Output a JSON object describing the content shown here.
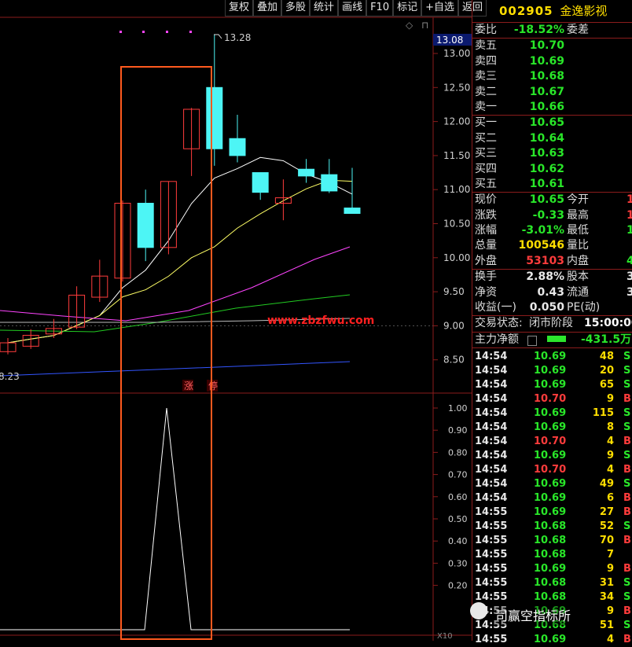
{
  "toolbar": [
    "复权",
    "叠加",
    "多股",
    "统计",
    "画线",
    "F10",
    "标记",
    "+自选",
    "返回"
  ],
  "colors": {
    "up": "#ff3c3c",
    "down": "#29e629",
    "flat": "#e8e8e8",
    "cyan_candle": "#4df5f5",
    "highlight_box": "#ff5a1e",
    "ma5": "#ffffff",
    "ma10": "#ffff66",
    "ma20": "#ff44ff",
    "ma60": "#22cc22",
    "ma_long": "#3355ff"
  },
  "chart": {
    "price_axis": [
      "13.00",
      "12.50",
      "12.00",
      "11.50",
      "11.00",
      "10.50",
      "10.00",
      "9.50",
      "9.00",
      "8.50"
    ],
    "current_price_tag": "13.08",
    "high_label": "13.28",
    "low_label": "8.23",
    "url_text": "www.zbzfwu.com",
    "signal_labels": [
      "涨",
      "停"
    ],
    "indicator_axis": [
      "1.00",
      "0.90",
      "0.80",
      "0.70",
      "0.60",
      "0.50",
      "0.40",
      "0.30",
      "0.20"
    ],
    "indicator_note": "X10",
    "candles": [
      {
        "o": 8.62,
        "c": 8.75,
        "h": 8.82,
        "l": 8.58
      },
      {
        "o": 8.7,
        "c": 8.86,
        "h": 8.95,
        "l": 8.66
      },
      {
        "o": 8.88,
        "c": 8.96,
        "h": 9.1,
        "l": 8.82
      },
      {
        "o": 8.98,
        "c": 9.45,
        "h": 9.58,
        "l": 8.95
      },
      {
        "o": 9.42,
        "c": 9.73,
        "h": 9.97,
        "l": 9.35
      },
      {
        "o": 9.7,
        "c": 10.8,
        "h": 10.84,
        "l": 9.65
      },
      {
        "o": 10.8,
        "c": 10.15,
        "h": 11.0,
        "l": 9.95
      },
      {
        "o": 10.15,
        "c": 11.12,
        "h": 11.12,
        "l": 10.05
      },
      {
        "o": 11.6,
        "c": 12.18,
        "h": 12.2,
        "l": 11.2
      },
      {
        "o": 12.5,
        "c": 11.6,
        "h": 13.28,
        "l": 11.35
      },
      {
        "o": 11.75,
        "c": 11.5,
        "h": 12.1,
        "l": 11.4
      },
      {
        "o": 11.25,
        "c": 10.96,
        "h": 11.25,
        "l": 10.85
      },
      {
        "o": 10.8,
        "c": 10.88,
        "h": 11.15,
        "l": 10.55
      },
      {
        "o": 11.3,
        "c": 11.2,
        "h": 11.45,
        "l": 11.1
      },
      {
        "o": 11.22,
        "c": 10.98,
        "h": 11.45,
        "l": 10.95
      },
      {
        "o": 10.73,
        "c": 10.65,
        "h": 11.32,
        "l": 10.65
      }
    ],
    "indicator_values": [
      0,
      0,
      0,
      0,
      0,
      0,
      0,
      1,
      0,
      0,
      0,
      0,
      0,
      0,
      0
    ]
  },
  "quote": {
    "code": "002905",
    "name": "金逸影视",
    "weibi_label": "委比",
    "weibi": "-18.52%",
    "weicha_label": "委差",
    "asks": [
      {
        "label": "卖五",
        "price": "10.70"
      },
      {
        "label": "卖四",
        "price": "10.69"
      },
      {
        "label": "卖三",
        "price": "10.68"
      },
      {
        "label": "卖二",
        "price": "10.67"
      },
      {
        "label": "卖一",
        "price": "10.66"
      }
    ],
    "bids": [
      {
        "label": "买一",
        "price": "10.65"
      },
      {
        "label": "买二",
        "price": "10.64"
      },
      {
        "label": "买三",
        "price": "10.63"
      },
      {
        "label": "买四",
        "price": "10.62"
      },
      {
        "label": "买五",
        "price": "10.61"
      }
    ],
    "stats1": [
      {
        "l1": "现价",
        "v1": "10.65",
        "c1": "green",
        "l2": "今开",
        "v2": "1",
        "c2": "red"
      },
      {
        "l1": "涨跌",
        "v1": "-0.33",
        "c1": "green",
        "l2": "最高",
        "v2": "1",
        "c2": "red"
      },
      {
        "l1": "涨幅",
        "v1": "-3.01%",
        "c1": "green",
        "l2": "最低",
        "v2": "1",
        "c2": "green"
      },
      {
        "l1": "总量",
        "v1": "100546",
        "c1": "yellow",
        "l2": "量比",
        "v2": "",
        "c2": "white"
      },
      {
        "l1": "外盘",
        "v1": "53103",
        "c1": "red",
        "l2": "内盘",
        "v2": "4",
        "c2": "green"
      }
    ],
    "stats2": [
      {
        "l1": "换手",
        "v1": "2.88%",
        "c1": "white",
        "l2": "股本",
        "v2": "3.",
        "c2": "white"
      },
      {
        "l1": "净资",
        "v1": "0.43",
        "c1": "white",
        "l2": "流通",
        "v2": "3.",
        "c2": "white"
      },
      {
        "l1": "收益(一)",
        "v1": "0.050",
        "c1": "white",
        "l2": "PE(动)",
        "v2": "",
        "c2": "white"
      }
    ],
    "trade_status_label": "交易状态:",
    "trade_status": "闭市阶段",
    "trade_time": "15:00:00",
    "main_flow_label": "主力净额",
    "main_flow_value": "-431.5万"
  },
  "ticks": [
    {
      "t": "14:54",
      "p": "10.69",
      "q": "48",
      "d": "S"
    },
    {
      "t": "14:54",
      "p": "10.69",
      "q": "20",
      "d": "S"
    },
    {
      "t": "14:54",
      "p": "10.69",
      "q": "65",
      "d": "S"
    },
    {
      "t": "14:54",
      "p": "10.70",
      "q": "9",
      "d": "B"
    },
    {
      "t": "14:54",
      "p": "10.69",
      "q": "115",
      "d": "S"
    },
    {
      "t": "14:54",
      "p": "10.69",
      "q": "8",
      "d": "S"
    },
    {
      "t": "14:54",
      "p": "10.70",
      "q": "4",
      "d": "B"
    },
    {
      "t": "14:54",
      "p": "10.69",
      "q": "9",
      "d": "S"
    },
    {
      "t": "14:54",
      "p": "10.70",
      "q": "4",
      "d": "B"
    },
    {
      "t": "14:54",
      "p": "10.69",
      "q": "49",
      "d": "S"
    },
    {
      "t": "14:54",
      "p": "10.69",
      "q": "6",
      "d": "B"
    },
    {
      "t": "14:55",
      "p": "10.69",
      "q": "27",
      "d": "B"
    },
    {
      "t": "14:55",
      "p": "10.68",
      "q": "52",
      "d": "S"
    },
    {
      "t": "14:55",
      "p": "10.68",
      "q": "70",
      "d": "B"
    },
    {
      "t": "14:55",
      "p": "10.68",
      "q": "7",
      "d": ""
    },
    {
      "t": "14:55",
      "p": "10.69",
      "q": "9",
      "d": "B"
    },
    {
      "t": "14:55",
      "p": "10.68",
      "q": "31",
      "d": "S"
    },
    {
      "t": "14:55",
      "p": "10.68",
      "q": "34",
      "d": "S"
    },
    {
      "t": "14:55",
      "p": "10.69",
      "q": "9",
      "d": "B"
    },
    {
      "t": "14:55",
      "p": "10.68",
      "q": "51",
      "d": "S"
    },
    {
      "t": "14:55",
      "p": "10.69",
      "q": "4",
      "d": "B"
    }
  ],
  "watermark": "司赢空指标所"
}
